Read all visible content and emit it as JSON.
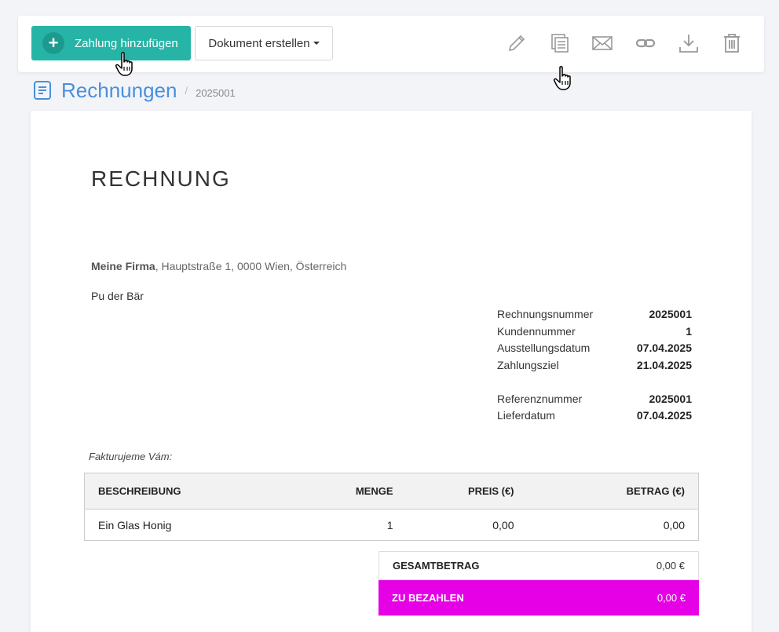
{
  "toolbar": {
    "add_payment_label": "Zahlung hinzufügen",
    "create_document_label": "Dokument erstellen",
    "primary_color": "#26b4a6",
    "icons": [
      "pencil-icon",
      "copy-icon",
      "mail-icon",
      "link-icon",
      "download-icon",
      "trash-icon"
    ]
  },
  "breadcrumb": {
    "title": "Rechnungen",
    "separator": "/",
    "number": "2025001"
  },
  "document": {
    "title": "RECHNUNG",
    "sender_name": "Meine Firma",
    "sender_address": ", Hauptstraße 1, 0000 Wien, Österreich",
    "recipient": "Pu der Bär",
    "meta_main": [
      {
        "label": "Rechnungsnummer",
        "value": "2025001"
      },
      {
        "label": "Kundennummer",
        "value": "1"
      },
      {
        "label": "Ausstellungsdatum",
        "value": "07.04.2025"
      },
      {
        "label": "Zahlungsziel",
        "value": "21.04.2025"
      }
    ],
    "meta_extra": [
      {
        "label": "Referenznummer",
        "value": "2025001"
      },
      {
        "label": "Lieferdatum",
        "value": "07.04.2025"
      }
    ],
    "intro_text": "Fakturujeme Vám:",
    "table": {
      "headers": {
        "description": "BESCHREIBUNG",
        "quantity": "MENGE",
        "price": "PREIS (€)",
        "amount": "BETRAG (€)"
      },
      "rows": [
        {
          "description": "Ein Glas Honig",
          "quantity": "1",
          "price": "0,00",
          "amount": "0,00"
        }
      ]
    },
    "totals": {
      "total_label": "GESAMTBETRAG",
      "total_value": "0,00 €",
      "due_label": "ZU BEZAHLEN",
      "due_value": "0,00 €",
      "due_color": "#e600e6"
    }
  }
}
